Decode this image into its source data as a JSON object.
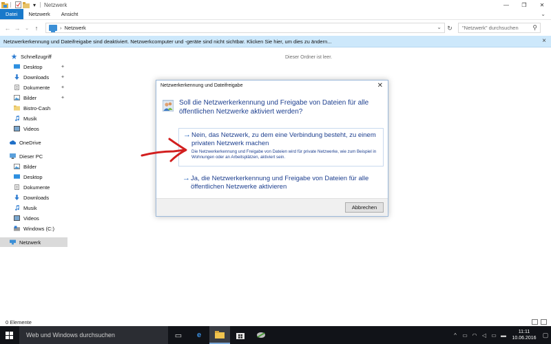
{
  "colors": {
    "accent": "#1979ca",
    "infobar": "#cde8fb",
    "dialog_text": "#1d3f8f",
    "annotation": "#d21f1f",
    "taskbar": "#111318"
  },
  "titlebar": {
    "title": "Netzwerk",
    "icons": [
      "explorer-icon",
      "properties-icon",
      "new-folder-icon",
      "dropdown-icon"
    ]
  },
  "ribbon": {
    "tabs": [
      {
        "label": "Datei"
      },
      {
        "label": "Netzwerk"
      },
      {
        "label": "Ansicht"
      }
    ]
  },
  "address": {
    "path": "Netzwerk",
    "search_placeholder": "\"Netzwerk\" durchsuchen"
  },
  "infobar": {
    "text": "Netzwerkerkennung und Dateifreigabe sind deaktiviert. Netzwerkcomputer und -geräte sind nicht sichtbar. Klicken Sie hier, um dies zu ändern..."
  },
  "sidebar": {
    "quick_access": "Schnellzugriff",
    "quick_items": [
      {
        "label": "Desktop",
        "icon": "desktop-icon"
      },
      {
        "label": "Downloads",
        "icon": "download-icon"
      },
      {
        "label": "Dokumente",
        "icon": "document-icon"
      },
      {
        "label": "Bilder",
        "icon": "pictures-icon"
      },
      {
        "label": "Bistro-Cash",
        "icon": "folder-icon"
      },
      {
        "label": "Musik",
        "icon": "music-icon"
      },
      {
        "label": "Videos",
        "icon": "video-icon"
      }
    ],
    "onedrive": "OneDrive",
    "this_pc": "Dieser PC",
    "pc_items": [
      {
        "label": "Bilder",
        "icon": "pictures-icon"
      },
      {
        "label": "Desktop",
        "icon": "desktop-icon"
      },
      {
        "label": "Dokumente",
        "icon": "document-icon"
      },
      {
        "label": "Downloads",
        "icon": "download-icon"
      },
      {
        "label": "Musik",
        "icon": "music-icon"
      },
      {
        "label": "Videos",
        "icon": "video-icon"
      },
      {
        "label": "Windows (C:)",
        "icon": "drive-icon"
      }
    ],
    "network": "Netzwerk"
  },
  "content": {
    "empty_text": "Dieser Ordner ist leer."
  },
  "status": {
    "items": "0 Elemente"
  },
  "dialog": {
    "title": "Netzwerkerkennung und Dateifreigabe",
    "question": "Soll die Netzwerkerkennung und Freigabe von Dateien für alle öffentlichen Netzwerke aktiviert werden?",
    "option1_title": "Nein, das Netzwerk, zu dem eine Verbindung besteht, zu einem privaten Netzwerk machen",
    "option1_desc": "Die Netzwerkerkennung und Freigabe von Dateien wird für private Netzwerke, wie zum Beispiel in Wohnungen oder an Arbeitsplätzen, aktiviert sein.",
    "option2_title": "Ja, die Netzwerkerkennung und Freigabe von Dateien für alle öffentlichen Netzwerke aktivieren",
    "cancel": "Abbrechen"
  },
  "taskbar": {
    "search_placeholder": "Web und Windows durchsuchen",
    "apps": [
      "task-view-icon",
      "edge-icon",
      "file-explorer-icon",
      "store-icon",
      "app-icon"
    ],
    "clock_time": "11:11",
    "clock_date": "10.06.2016"
  }
}
